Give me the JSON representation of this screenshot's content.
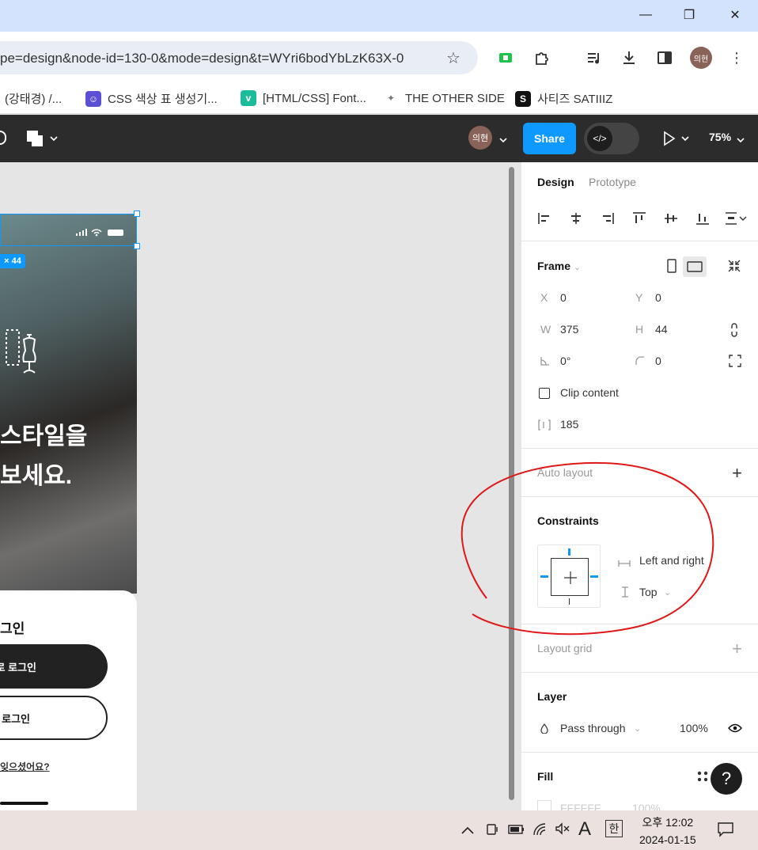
{
  "browser": {
    "url": "pe=design&node-id=130-0&mode=design&t=WYri6bodYbLzK63X-0",
    "profile_initials": "의현",
    "window_controls": {
      "minimize": "—",
      "restore": "❐",
      "close": "✕"
    },
    "bookmarks": [
      {
        "label": "(강태경) /..."
      },
      {
        "label": "CSS 색상 표 생성기..."
      },
      {
        "label": "[HTML/CSS] Font..."
      },
      {
        "label": "THE OTHER SIDE"
      },
      {
        "label": "사티즈 SATIIIZ"
      }
    ],
    "toolbar_icons": [
      "star-icon",
      "extension-green-icon",
      "puzzle-icon",
      "media-icon",
      "download-icon",
      "sidepanel-icon",
      "menu-icon"
    ]
  },
  "figma": {
    "avatar_initials": "의현",
    "share_label": "Share",
    "dev_mode_glyph": "</>",
    "zoom": "75%",
    "canvas": {
      "dimension_badge": "× 44",
      "hero_line1": "스타일을",
      "hero_line2": "보세요.",
      "login_title": "그인",
      "btn_primary": "로 로그인",
      "btn_secondary": "로그인",
      "forgot_link": "잊으셨어요?"
    },
    "panel": {
      "tabs": [
        "Design",
        "Prototype"
      ],
      "frame_label": "Frame",
      "x_label": "X",
      "x_value": "0",
      "y_label": "Y",
      "y_value": "0",
      "w_label": "W",
      "w_value": "375",
      "h_label": "H",
      "h_value": "44",
      "rotation_value": "0°",
      "radius_value": "0",
      "clip_content_label": "Clip content",
      "spacing_value": "185",
      "auto_layout_label": "Auto layout",
      "constraints_label": "Constraints",
      "constraint_horizontal": "Left and right",
      "constraint_vertical": "Top",
      "layout_grid_label": "Layout grid",
      "layer_label": "Layer",
      "blend_mode": "Pass through",
      "layer_opacity": "100%",
      "fill_label": "Fill",
      "fill_hex": "FFFFFF",
      "fill_opacity": "100%",
      "help_glyph": "?"
    }
  },
  "taskbar": {
    "ime_label": "A",
    "lang_label": "한",
    "time": "오후 12:02",
    "date": "2024-01-15"
  },
  "colors": {
    "accent": "#0d99ff",
    "annotation": "#e01818"
  }
}
